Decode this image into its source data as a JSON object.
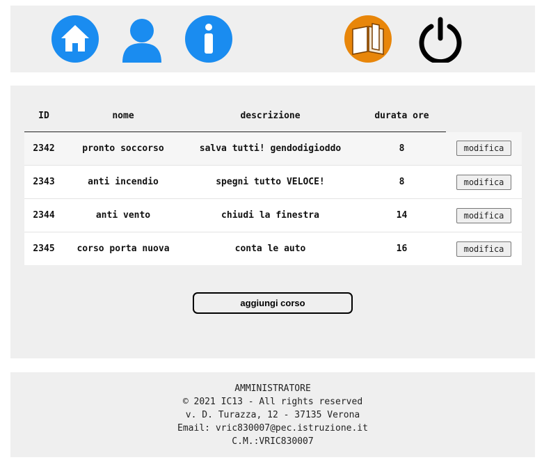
{
  "nav": {
    "icons": [
      "home-icon",
      "user-icon",
      "info-icon",
      "book-icon",
      "power-icon"
    ],
    "colors": {
      "blue": "#1a8cf0",
      "orange": "#e8860a",
      "black": "#000000"
    }
  },
  "table": {
    "headers": {
      "id": "ID",
      "nome": "nome",
      "descrizione": "descrizione",
      "durata": "durata ore"
    },
    "rows": [
      {
        "id": "2342",
        "nome": "pronto soccorso",
        "descrizione": "salva tutti! gendodigioddo",
        "durata": "8",
        "action": "modifica"
      },
      {
        "id": "2343",
        "nome": "anti incendio",
        "descrizione": "spegni tutto VELOCE!",
        "durata": "8",
        "action": "modifica"
      },
      {
        "id": "2344",
        "nome": "anti vento",
        "descrizione": "chiudi la finestra",
        "durata": "14",
        "action": "modifica"
      },
      {
        "id": "2345",
        "nome": "corso porta nuova",
        "descrizione": "conta le auto",
        "durata": "16",
        "action": "modifica"
      }
    ]
  },
  "add_button": "aggiungi corso",
  "footer": {
    "role": "AMMINISTRATORE",
    "copyright": "© 2021 IC13 - All rights reserved",
    "address": "v. D. Turazza, 12 - 37135 Verona",
    "email": "Email: vric830007@pec.istruzione.it",
    "cm": "C.M.:VRIC830007"
  }
}
